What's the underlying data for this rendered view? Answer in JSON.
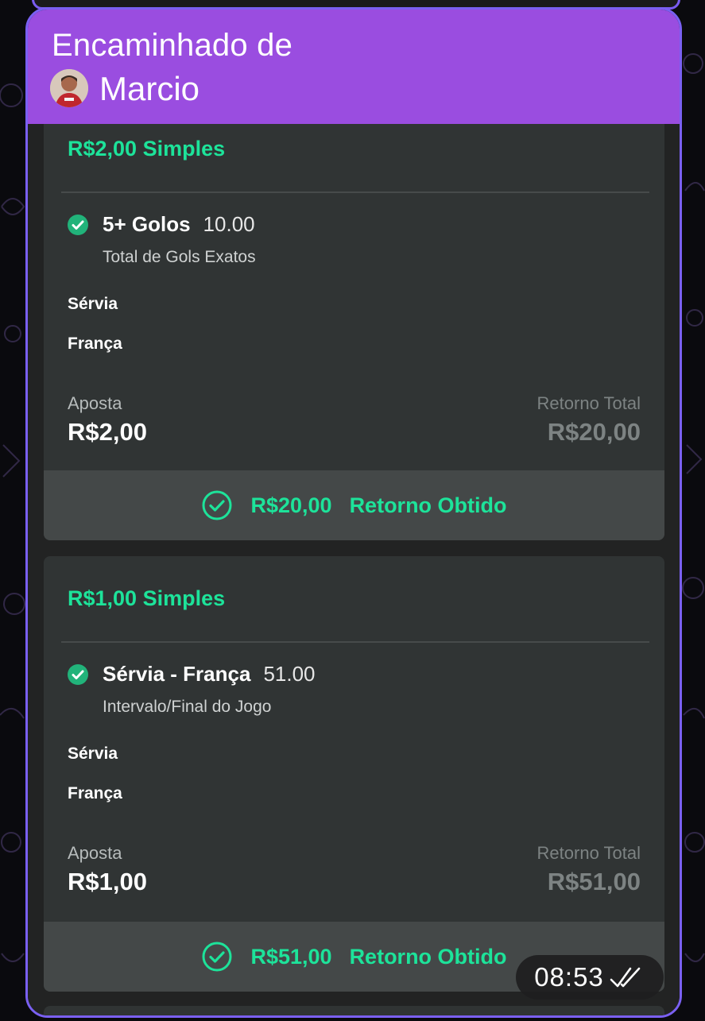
{
  "forward": {
    "label": "Encaminhado de",
    "sender": "Marcio"
  },
  "bets": [
    {
      "title": "R$2,00 Simples",
      "selection": "5+ Golos",
      "odds": "10.00",
      "market": "Total de Gols Exatos",
      "team_home": "Sérvia",
      "team_away": "França",
      "stake_label": "Aposta",
      "stake": "R$2,00",
      "return_label": "Retorno Total",
      "return_total": "R$20,00",
      "won_amount": "R$20,00",
      "won_label": "Retorno Obtido"
    },
    {
      "title": "R$1,00 Simples",
      "selection": "Sérvia - França",
      "odds": "51.00",
      "market": "Intervalo/Final do Jogo",
      "team_home": "Sérvia",
      "team_away": "França",
      "stake_label": "Aposta",
      "stake": "R$1,00",
      "return_label": "Retorno Total",
      "return_total": "R$51,00",
      "won_amount": "R$51,00",
      "won_label": "Retorno Obtido"
    }
  ],
  "message": {
    "time": "08:53",
    "status_icon": "double-check-icon"
  },
  "colors": {
    "forward_header": "#9a4de0",
    "bubble_border": "#7a60f2",
    "accent_green": "#1de39a",
    "card_bg": "#303434",
    "footer_bg": "#444848"
  }
}
